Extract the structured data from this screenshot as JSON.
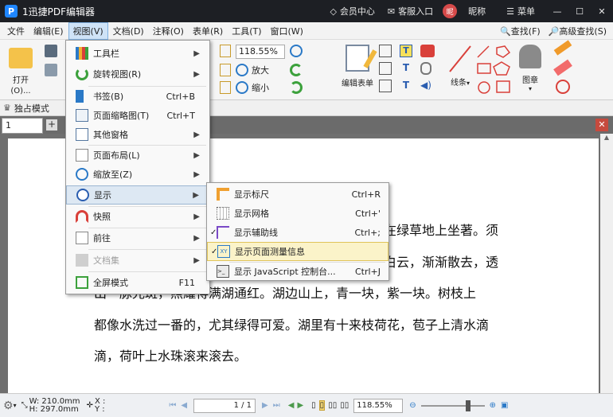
{
  "app": {
    "logo_letter": "P",
    "title": "1迅捷PDF编辑器"
  },
  "titlebar": {
    "member": "会员中心",
    "service": "客服入口",
    "avatar": "昵",
    "nickname": "昵称",
    "menu": "菜单",
    "minimize": "—",
    "maximize": "☐",
    "close": "✕"
  },
  "menubar": {
    "items": [
      "文件",
      "编辑(E)",
      "视图(V)",
      "文档(D)",
      "注释(O)",
      "表单(R)",
      "工具(T)",
      "窗口(W)"
    ],
    "search": "查找(F)",
    "advanced_search": "高级查找(S)"
  },
  "ribbon": {
    "open": "打开(O)...",
    "zoom_value": "118.55%",
    "zoom_in": "放大",
    "zoom_out": "缩小",
    "edit_form": "编辑表单",
    "lines": "线条",
    "stamp": "图章"
  },
  "subbar": {
    "exclusive_mode": "独占模式"
  },
  "tabs": {
    "tab1": "1",
    "add": "+",
    "close": "✕"
  },
  "view_menu": {
    "items": [
      {
        "label": "工具栏",
        "shortcut": "",
        "submenu": true
      },
      {
        "label": "旋转视图(R)",
        "shortcut": "",
        "submenu": true
      },
      {
        "label": "书签(B)",
        "shortcut": "Ctrl+B",
        "submenu": false
      },
      {
        "label": "页面缩略图(T)",
        "shortcut": "Ctrl+T",
        "submenu": false
      },
      {
        "label": "其他窗格",
        "shortcut": "",
        "submenu": true
      },
      {
        "label": "页面布局(L)",
        "shortcut": "",
        "submenu": true
      },
      {
        "label": "缩放至(Z)",
        "shortcut": "",
        "submenu": true
      },
      {
        "label": "显示",
        "shortcut": "",
        "submenu": true
      },
      {
        "label": "快照",
        "shortcut": "",
        "submenu": true
      },
      {
        "label": "前往",
        "shortcut": "",
        "submenu": true
      },
      {
        "label": "文档集",
        "shortcut": "",
        "submenu": true
      },
      {
        "label": "全屏模式",
        "shortcut": "F11",
        "submenu": false
      }
    ]
  },
  "show_submenu": {
    "items": [
      {
        "label": "显示标尺",
        "shortcut": "Ctrl+R"
      },
      {
        "label": "显示网格",
        "shortcut": "Ctrl+'"
      },
      {
        "label": "显示辅助线",
        "shortcut": "Ctrl+;"
      },
      {
        "label": "显示页面测量信息",
        "shortcut": ""
      },
      {
        "label": "显示 JavaScript 控制台...",
        "shortcut": "Ctrl+J"
      }
    ]
  },
  "document": {
    "lines": [
      "在绿草地上坐著。须",
      "白云，渐渐散去，透",
      "出一脉光斑，照耀得满湖通红。湖边山上，青一块，紫一块。树枝上",
      "都像水洗过一番的，尤其绿得可爱。湖里有十来枝荷花，苞子上清水滴",
      "滴，荷叶上水珠滚来滚去。"
    ]
  },
  "status": {
    "width": "W: 210.0mm",
    "height": "H: 297.0mm",
    "x": "X :",
    "y": "Y :",
    "page": "1 / 1",
    "zoom": "118.55%"
  },
  "colors": {
    "accent": "#1f86ff",
    "menu_active": "#cfe3f7",
    "checked": "#fbf3c9"
  }
}
